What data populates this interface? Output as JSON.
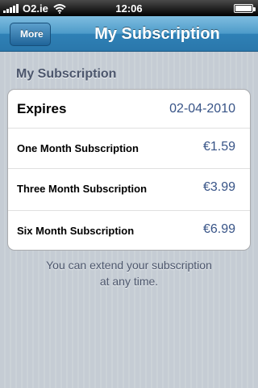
{
  "status_bar": {
    "carrier": "O2.ie",
    "time": "12:06"
  },
  "nav": {
    "back_label": "More",
    "title": "My Subscription"
  },
  "section": {
    "header": "My Subscription"
  },
  "rows": [
    {
      "label": "Expires",
      "value": "02-04-2010"
    },
    {
      "label": "One Month Subscription",
      "value": "€1.59"
    },
    {
      "label": "Three Month Subscription",
      "value": "€3.99"
    },
    {
      "label": "Six Month Subscription",
      "value": "€6.99"
    }
  ],
  "footer": {
    "line1": "You can extend your subscription",
    "line2": "at any time."
  },
  "colors": {
    "nav_bar": "#2f81b6",
    "value_text": "#385487",
    "background": "#c5ccd4"
  },
  "icons": [
    "signal-bars-icon",
    "wifi-icon",
    "battery-icon"
  ]
}
